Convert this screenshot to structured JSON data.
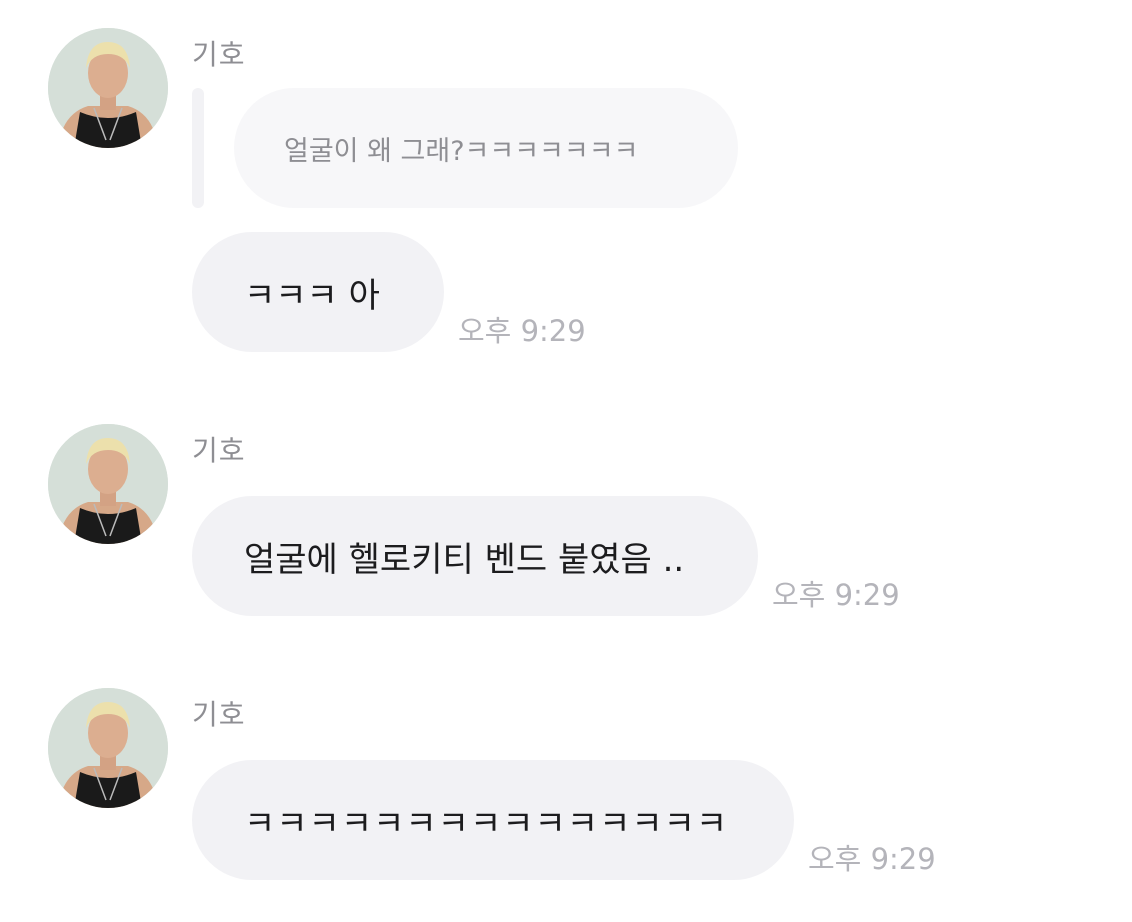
{
  "messages": [
    {
      "sender": "기호",
      "quoted_reply": "얼굴이 왜 그래?ㅋㅋㅋㅋㅋㅋㅋ",
      "text": "ㅋㅋㅋ 아",
      "time": "오후 9:29"
    },
    {
      "sender": "기호",
      "text": "얼굴에 헬로키티 벤드 붙였음 ..",
      "time": "오후 9:29"
    },
    {
      "sender": "기호",
      "text": "ㅋㅋㅋㅋㅋㅋㅋㅋㅋㅋㅋㅋㅋㅋㅋ",
      "time": "오후 9:29"
    }
  ],
  "colors": {
    "bubble_bg": "#f2f2f5",
    "reply_bg": "#f7f7f9",
    "name_text": "#8e8e93",
    "time_text": "#b4b4ba",
    "message_text": "#1c1c1e"
  },
  "icons": {
    "avatar": "profile-photo"
  }
}
